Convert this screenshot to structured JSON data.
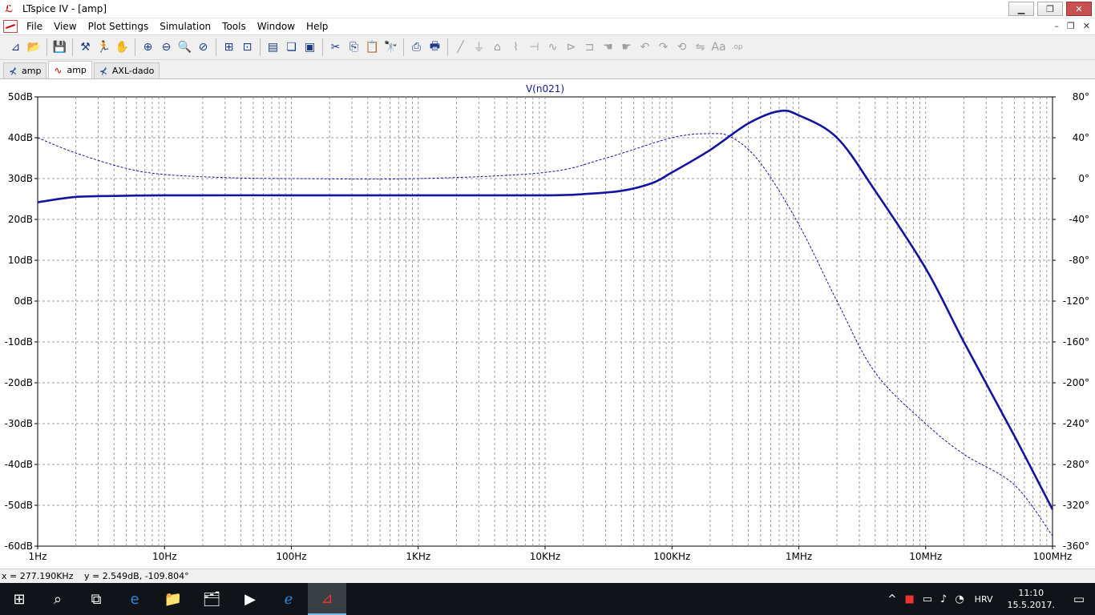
{
  "window": {
    "title": "LTspice IV - [amp]",
    "minimize": "▁",
    "restore": "❐",
    "close": "✕"
  },
  "menu": {
    "items": [
      {
        "label": "File"
      },
      {
        "label": "View"
      },
      {
        "label": "Plot Settings"
      },
      {
        "label": "Simulation"
      },
      {
        "label": "Tools"
      },
      {
        "label": "Window"
      },
      {
        "label": "Help"
      }
    ],
    "mdi_min": "–",
    "mdi_restore": "❐",
    "mdi_close": "✕"
  },
  "toolbar": {
    "groups": [
      [
        "schematic-new-icon",
        "open-folder-icon"
      ],
      [
        "save-icon"
      ],
      [
        "control-panel-icon",
        "run-icon",
        "halt-icon"
      ],
      [
        "zoom-in-icon",
        "zoom-out-icon",
        "zoom-fit-icon",
        "zoom-cancel-icon"
      ],
      [
        "autorange-icon",
        "pan-icon"
      ],
      [
        "tile-horizontal-icon",
        "cascade-icon",
        "close-windows-icon"
      ],
      [
        "cut-icon",
        "copy-icon",
        "paste-icon",
        "find-icon"
      ],
      [
        "print-icon",
        "print-setup-icon"
      ],
      [
        "wire-icon",
        "ground-icon",
        "label-icon",
        "resistor-icon",
        "capacitor-icon",
        "inductor-icon",
        "diode-icon",
        "component-icon",
        "move-icon",
        "drag-icon",
        "undo-icon",
        "redo-icon",
        "rotate-icon",
        "mirror-icon",
        "text-icon",
        "spice-directive-icon"
      ]
    ],
    "glyphs": {
      "schematic-new-icon": "⊿",
      "open-folder-icon": "📂",
      "save-icon": "💾",
      "control-panel-icon": "⚒",
      "run-icon": "🏃",
      "halt-icon": "✋",
      "zoom-in-icon": "⊕",
      "zoom-out-icon": "⊖",
      "zoom-fit-icon": "🔍",
      "zoom-cancel-icon": "⊘",
      "autorange-icon": "⊞",
      "pan-icon": "⊡",
      "tile-horizontal-icon": "▤",
      "cascade-icon": "❏",
      "close-windows-icon": "▣",
      "cut-icon": "✂",
      "copy-icon": "⎘",
      "paste-icon": "📋",
      "find-icon": "🔭",
      "print-icon": "⎙",
      "print-setup-icon": "🖶",
      "wire-icon": "╱",
      "ground-icon": "⏚",
      "label-icon": "⌂",
      "resistor-icon": "⌇",
      "capacitor-icon": "⊣",
      "inductor-icon": "∿",
      "diode-icon": "⊳",
      "component-icon": "⊐",
      "move-icon": "☚",
      "drag-icon": "☛",
      "undo-icon": "↶",
      "redo-icon": "↷",
      "rotate-icon": "⟲",
      "mirror-icon": "⇋",
      "text-icon": "Aa",
      "spice-directive-icon": ".op"
    }
  },
  "tabs": [
    {
      "label": "amp",
      "icon": "schematic-icon",
      "glyph": "⊀",
      "active": false
    },
    {
      "label": "amp",
      "icon": "waveform-icon",
      "glyph": "∿",
      "active": true
    },
    {
      "label": "AXL-dado",
      "icon": "schematic-icon",
      "glyph": "⊀",
      "active": false
    }
  ],
  "colors": {
    "trace": "#1414a0",
    "grid": "#9a9a9a",
    "axis_text": "#000000"
  },
  "chart_data": {
    "type": "line",
    "title": "V(n021)",
    "xscale": "log",
    "xlim_hz": [
      1,
      100000000
    ],
    "x_ticks": [
      "1Hz",
      "10Hz",
      "100Hz",
      "1KHz",
      "10KHz",
      "100KHz",
      "1MHz",
      "10MHz",
      "100MHz"
    ],
    "y_left_ticks": [
      "50dB",
      "40dB",
      "30dB",
      "20dB",
      "10dB",
      "0dB",
      "-10dB",
      "-20dB",
      "-30dB",
      "-40dB",
      "-50dB",
      "-60dB"
    ],
    "ylim_db": [
      -60,
      50
    ],
    "y_right_ticks": [
      "80°",
      "40°",
      "0°",
      "-40°",
      "-80°",
      "-120°",
      "-160°",
      "-200°",
      "-240°",
      "-280°",
      "-320°",
      "-360°"
    ],
    "ylim_deg": [
      -360,
      80
    ],
    "grid": true,
    "series": [
      {
        "style": "solid",
        "axis": "left",
        "x": [
          1,
          2,
          5,
          10,
          100,
          1000,
          10000,
          20000,
          40000,
          70000,
          100000,
          200000,
          400000,
          700000,
          1000000,
          2000000,
          4000000,
          10000000,
          20000000,
          50000000,
          100000000
        ],
        "y": [
          24.2,
          25.5,
          25.8,
          25.9,
          25.9,
          25.9,
          25.9,
          26.2,
          27.0,
          28.9,
          31.5,
          37.0,
          43.5,
          46.5,
          45.5,
          40.0,
          27.0,
          8.0,
          -10.0,
          -33.0,
          -51.0
        ]
      },
      {
        "style": "dashed",
        "axis": "right",
        "x": [
          1,
          2,
          5,
          10,
          30,
          100,
          1000,
          10000,
          30000,
          100000,
          200000,
          300000,
          500000,
          1000000,
          2000000,
          4000000,
          10000000,
          20000000,
          50000000,
          100000000
        ],
        "y": [
          40,
          25,
          10,
          4,
          1,
          0,
          0,
          6,
          20,
          40,
          44,
          40,
          15,
          -45,
          -120,
          -190,
          -240,
          -270,
          -300,
          -350
        ]
      }
    ]
  },
  "status": {
    "x_readout": "x = 277.190KHz",
    "y_readout": "y = 2.549dB, -109.804°"
  },
  "taskbar": {
    "apps": [
      {
        "name": "start-icon",
        "glyph": "⊞"
      },
      {
        "name": "search-icon",
        "glyph": "⌕"
      },
      {
        "name": "task-view-icon",
        "glyph": "⧉"
      },
      {
        "name": "edge-icon",
        "glyph": "e"
      },
      {
        "name": "file-explorer-icon",
        "glyph": "📁"
      },
      {
        "name": "photos-icon",
        "glyph": "🗂"
      },
      {
        "name": "media-player-icon",
        "glyph": "▶"
      },
      {
        "name": "internet-explorer-icon",
        "glyph": "ℯ"
      },
      {
        "name": "ltspice-icon",
        "glyph": "⊿"
      }
    ],
    "tray": {
      "chevron": "^",
      "language": "HRV",
      "time": "11:10",
      "date": "15.5.2017."
    }
  }
}
